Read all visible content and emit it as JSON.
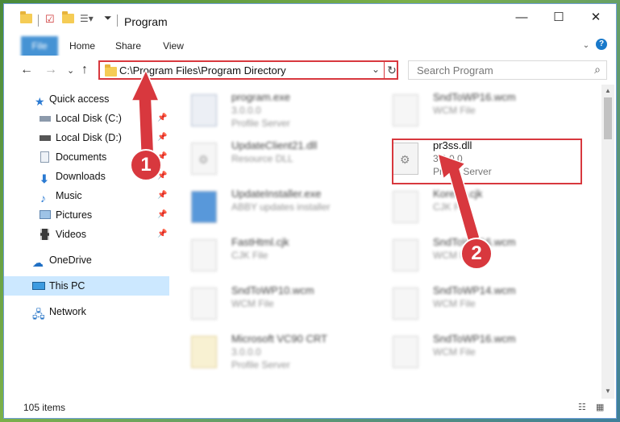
{
  "window": {
    "title": "Program",
    "controls": {
      "minimize": "—",
      "maximize": "☐",
      "close": "✕"
    }
  },
  "ribbon": {
    "tabs": [
      {
        "label": "File"
      },
      {
        "label": "Home"
      },
      {
        "label": "Share"
      },
      {
        "label": "View"
      }
    ],
    "help": "?"
  },
  "nav": {
    "back": "←",
    "forward": "→",
    "recent": "⌄",
    "up": "↑",
    "address": "C:\\Program Files\\Program Directory",
    "address_chevron": "⌄",
    "refresh": "↻",
    "search_placeholder": "Search Program",
    "search_icon": "search-icon"
  },
  "sidebar": {
    "items": [
      {
        "label": "Quick access",
        "icon": "star-icon"
      },
      {
        "label": "Local Disk (C:)",
        "icon": "drive-icon",
        "pin": "📌"
      },
      {
        "label": "Local Disk (D:)",
        "icon": "drive-icon",
        "pin": "📌"
      },
      {
        "label": "Documents",
        "icon": "documents-icon",
        "pin": "📌"
      },
      {
        "label": "Downloads",
        "icon": "download-icon",
        "pin": "📌"
      },
      {
        "label": "Music",
        "icon": "music-icon",
        "pin": "📌"
      },
      {
        "label": "Pictures",
        "icon": "pictures-icon",
        "pin": "📌"
      },
      {
        "label": "Videos",
        "icon": "videos-icon",
        "pin": "📌"
      },
      {
        "label": "OneDrive",
        "icon": "cloud-icon"
      },
      {
        "label": "This PC",
        "icon": "computer-icon"
      },
      {
        "label": "Network",
        "icon": "network-icon"
      }
    ]
  },
  "files": {
    "left": [
      {
        "name": "program.exe",
        "line2": "3.0.0.0",
        "line3": "Profile Server"
      },
      {
        "name": "UpdateClient21.dll",
        "line2": "Resource DLL",
        "line3": ""
      },
      {
        "name": "UpdateInstaller.exe",
        "line2": "ABBY updates installer",
        "line3": ""
      },
      {
        "name": "FastHtml.cjk",
        "line2": "CJK File",
        "line3": ""
      },
      {
        "name": "SndToWP10.wcm",
        "line2": "WCM File",
        "line3": ""
      },
      {
        "name": "Microsoft VC90 CRT",
        "line2": "3.0.0.0",
        "line3": "Profile Server"
      }
    ],
    "right": [
      {
        "name": "SndToWP16.wcm",
        "line2": "WCM File",
        "line3": ""
      },
      {
        "name": "pr3ss.dll",
        "line2": "3.0.0.0",
        "line3": "Profile Server"
      },
      {
        "name": "Korean.cjk",
        "line2": "CJK File",
        "line3": ""
      },
      {
        "name": "SndToWP16.wcm",
        "line2": "WCM File",
        "line3": ""
      },
      {
        "name": "SndToWP14.wcm",
        "line2": "WCM File",
        "line3": ""
      },
      {
        "name": "SndToWP16.wcm",
        "line2": "WCM File",
        "line3": ""
      }
    ]
  },
  "status": {
    "item_count": "105 items"
  },
  "callouts": [
    {
      "number": "1"
    },
    {
      "number": "2"
    }
  ],
  "colors": {
    "accent": "#1979ca",
    "highlight": "#d8383e",
    "selected": "#cce8ff"
  }
}
